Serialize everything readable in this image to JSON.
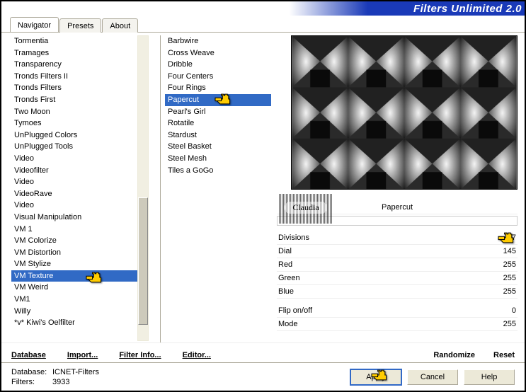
{
  "app_title": "Filters Unlimited 2.0",
  "tabs": [
    {
      "label": "Navigator",
      "active": true
    },
    {
      "label": "Presets",
      "active": false
    },
    {
      "label": "About",
      "active": false
    }
  ],
  "categories": [
    "Tormentia",
    "Tramages",
    "Transparency",
    "Tronds Filters II",
    "Tronds Filters",
    "Tronds First",
    "Two Moon",
    "Tymoes",
    "UnPlugged Colors",
    "UnPlugged Tools",
    "Video",
    "Videofilter",
    "Video",
    "VideoRave",
    "Video",
    "Visual Manipulation",
    "VM 1",
    "VM Colorize",
    "VM Distortion",
    "VM Stylize",
    "VM Texture",
    "VM Weird",
    "VM1",
    "Willy",
    "*v* Kiwi's Oelfilter"
  ],
  "category_selected_index": 20,
  "filters": [
    "Barbwire",
    "Cross Weave",
    "Dribble",
    "Four Centers",
    "Four Rings",
    "Papercut",
    "Pearl's Girl",
    "Rotatile",
    "Stardust",
    "Steel Basket",
    "Steel Mesh",
    "Tiles a GoGo"
  ],
  "filter_selected_index": 5,
  "current_filter_name": "Papercut",
  "params": [
    {
      "label": "Divisions",
      "value": 67
    },
    {
      "label": "Dial",
      "value": 145
    },
    {
      "label": "Red",
      "value": 255
    },
    {
      "label": "Green",
      "value": 255
    },
    {
      "label": "Blue",
      "value": 255
    }
  ],
  "params2": [
    {
      "label": "Flip on/off",
      "value": 0
    },
    {
      "label": "Mode",
      "value": 255
    }
  ],
  "link_buttons": {
    "database": "Database",
    "import": "Import...",
    "filter_info": "Filter Info...",
    "editor": "Editor...",
    "randomize": "Randomize",
    "reset": "Reset"
  },
  "footer": {
    "db_key": "Database:",
    "db_val": "ICNET-Filters",
    "filters_key": "Filters:",
    "filters_val": "3933",
    "apply": "Apply",
    "cancel": "Cancel",
    "help": "Help"
  },
  "watermark": "Claudia"
}
